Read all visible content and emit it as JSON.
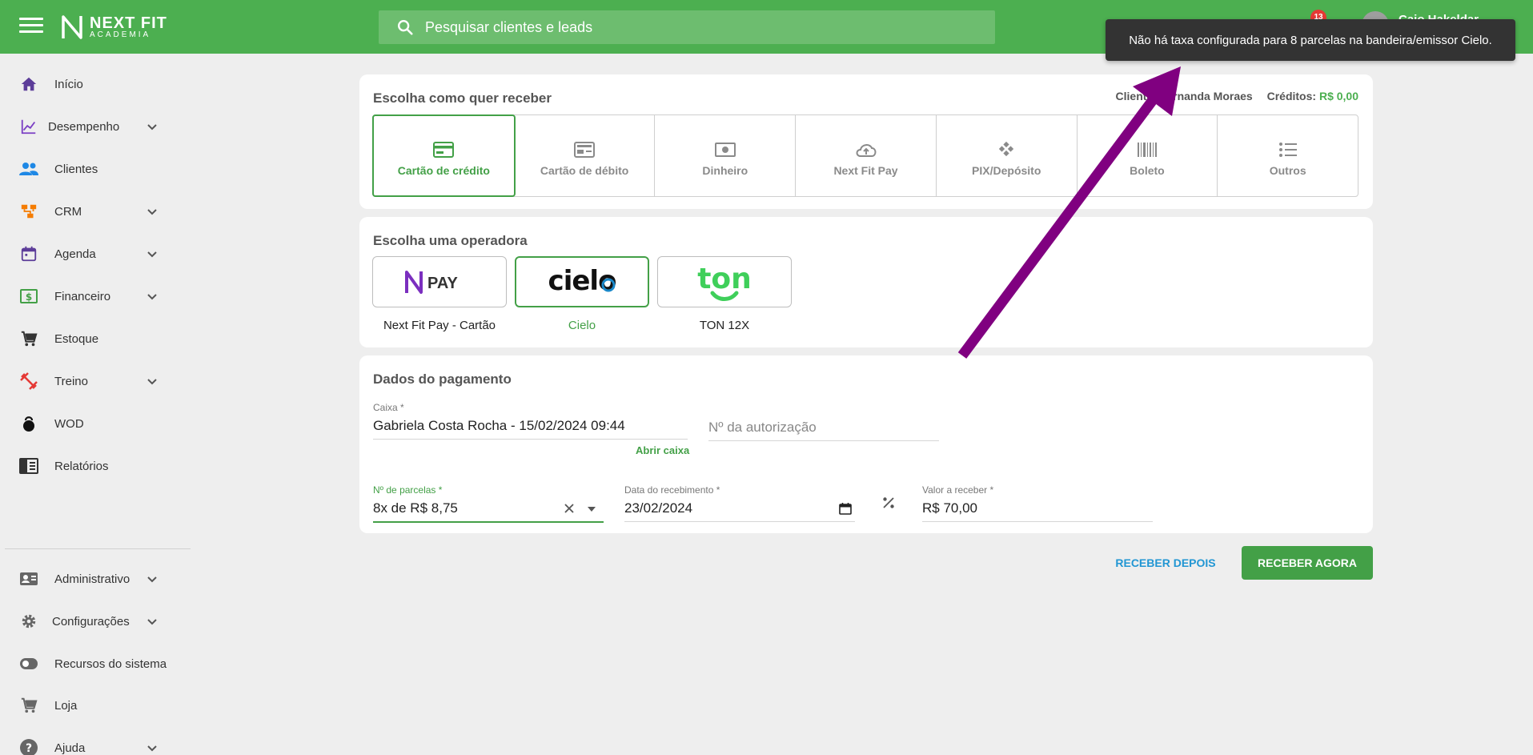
{
  "header": {
    "logo_main": "NEXT FIT",
    "logo_sub": "ACADEMIA",
    "search_placeholder": "Pesquisar clientes e leads",
    "notification_count": "13",
    "username": "Caio Hakeldar"
  },
  "tooltip": {
    "message": "Não há taxa configurada para 8 parcelas na bandeira/emissor Cielo."
  },
  "sidebar": {
    "items": [
      {
        "label": "Início",
        "icon": "home-icon",
        "color": "#5c3d99"
      },
      {
        "label": "Desempenho",
        "icon": "chart-line-icon",
        "color": "#7b3fc4",
        "expandable": true
      },
      {
        "label": "Clientes",
        "icon": "people-icon",
        "color": "#1e88e5"
      },
      {
        "label": "CRM",
        "icon": "crm-icon",
        "color": "#f57c00",
        "expandable": true
      },
      {
        "label": "Agenda",
        "icon": "calendar-icon",
        "color": "#5c3d99",
        "expandable": true
      },
      {
        "label": "Financeiro",
        "icon": "money-icon",
        "color": "#43a047",
        "expandable": true
      },
      {
        "label": "Estoque",
        "icon": "cart-icon",
        "color": "#333333"
      },
      {
        "label": "Treino",
        "icon": "dumbbell-icon",
        "color": "#e53935",
        "expandable": true
      },
      {
        "label": "WOD",
        "icon": "kettlebell-icon",
        "color": "#111111"
      },
      {
        "label": "Relatórios",
        "icon": "report-icon",
        "color": "#333333"
      },
      {
        "label": "Administrativo",
        "icon": "id-card-icon",
        "color": "#666666",
        "expandable": true
      },
      {
        "label": "Configurações",
        "icon": "gear-icon",
        "color": "#666666",
        "expandable": true
      },
      {
        "label": "Recursos do sistema",
        "icon": "toggle-icon",
        "color": "#666666"
      },
      {
        "label": "Loja",
        "icon": "cart-icon",
        "color": "#666666"
      },
      {
        "label": "Ajuda",
        "icon": "help-icon",
        "color": "#666666",
        "expandable": true
      }
    ]
  },
  "receive": {
    "title": "Escolha como quer receber",
    "client_label": "Cliente:",
    "client_name": "Fernanda Moraes",
    "credits_label": "Créditos:",
    "credits_value": "R$ 0,00",
    "methods": [
      {
        "label": "Cartão de crédito",
        "icon": "credit-card-icon",
        "active": true
      },
      {
        "label": "Cartão de débito",
        "icon": "debit-card-icon"
      },
      {
        "label": "Dinheiro",
        "icon": "cash-icon"
      },
      {
        "label": "Next Fit Pay",
        "icon": "cloud-upload-icon"
      },
      {
        "label": "PIX/Depósito",
        "icon": "pix-icon"
      },
      {
        "label": "Boleto",
        "icon": "barcode-icon"
      },
      {
        "label": "Outros",
        "icon": "list-icon"
      }
    ]
  },
  "operator": {
    "title": "Escolha uma operadora",
    "options": [
      {
        "label": "Next Fit Pay - Cartão",
        "logo_text": "PAY"
      },
      {
        "label": "Cielo",
        "logo_text": "cielo",
        "active": true
      },
      {
        "label": "TON 12X",
        "logo_text": "ton"
      }
    ]
  },
  "payment": {
    "title": "Dados do pagamento",
    "caixa_label": "Caixa *",
    "caixa_value": "Gabriela Costa Rocha - 15/02/2024 09:44",
    "auth_placeholder": "Nº da autorização",
    "abrir_caixa": "Abrir caixa",
    "parcelas_label": "Nº de parcelas *",
    "parcelas_value": "8x de R$ 8,75",
    "data_label": "Data do recebimento *",
    "data_value": "23/02/2024",
    "valor_label": "Valor a receber *",
    "valor_value": "R$ 70,00"
  },
  "actions": {
    "later": "RECEBER DEPOIS",
    "now": "RECEBER AGORA"
  },
  "colors": {
    "brand_green": "#4caf50",
    "accent_green": "#43a047",
    "link_blue": "#2196d3",
    "arrow_purple": "#800080"
  }
}
